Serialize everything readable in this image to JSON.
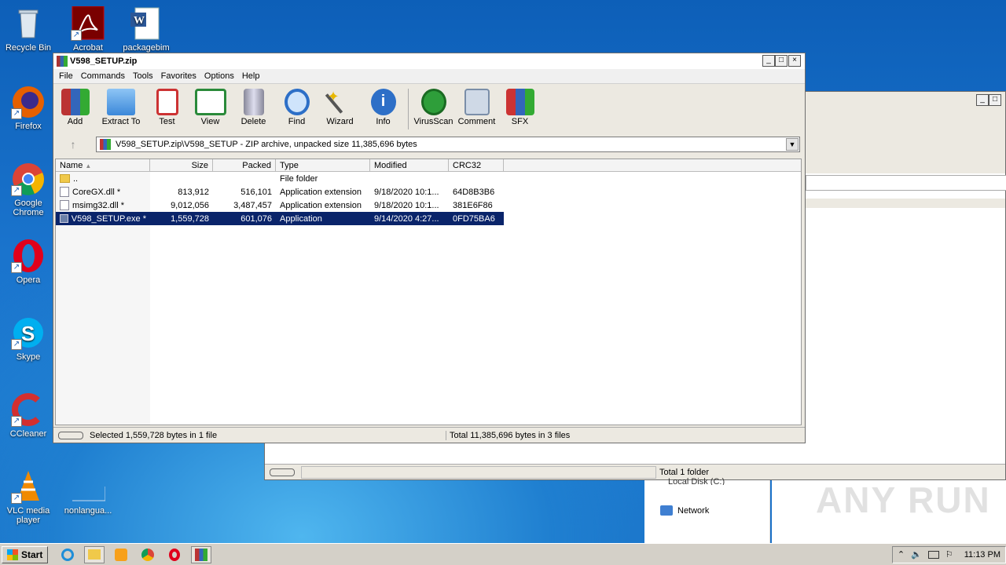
{
  "desktop": {
    "icons": [
      {
        "label": "Recycle Bin"
      },
      {
        "label": "Acrobat"
      },
      {
        "label": "packagebim"
      },
      {
        "label": "Firefox"
      },
      {
        "label": "Google Chrome"
      },
      {
        "label": "Opera"
      },
      {
        "label": "Skype"
      },
      {
        "label": "CCleaner"
      },
      {
        "label": "VLC media player"
      },
      {
        "label": "nonlangua..."
      }
    ]
  },
  "window": {
    "title": "V598_SETUP.zip",
    "menu": [
      "File",
      "Commands",
      "Tools",
      "Favorites",
      "Options",
      "Help"
    ],
    "toolbar": [
      "Add",
      "Extract To",
      "Test",
      "View",
      "Delete",
      "Find",
      "Wizard",
      "Info",
      "VirusScan",
      "Comment",
      "SFX"
    ],
    "address": "V598_SETUP.zip\\V598_SETUP - ZIP archive, unpacked size 11,385,696 bytes",
    "columns": [
      "Name",
      "Size",
      "Packed",
      "Type",
      "Modified",
      "CRC32"
    ],
    "rows": [
      {
        "name": "..",
        "size": "",
        "packed": "",
        "type": "File folder",
        "modified": "",
        "crc": ""
      },
      {
        "name": "CoreGX.dll *",
        "size": "813,912",
        "packed": "516,101",
        "type": "Application extension",
        "modified": "9/18/2020 10:1...",
        "crc": "64D8B3B6"
      },
      {
        "name": "msimg32.dll *",
        "size": "9,012,056",
        "packed": "3,487,457",
        "type": "Application extension",
        "modified": "9/18/2020 10:1...",
        "crc": "381E6F86"
      },
      {
        "name": "V598_SETUP.exe *",
        "size": "1,559,728",
        "packed": "601,076",
        "type": "Application",
        "modified": "9/14/2020 4:27...",
        "crc": "0FD75BA6"
      }
    ],
    "status_left": "Selected 1,559,728 bytes in 1 file",
    "status_right": "Total 11,385,696 bytes in 3 files"
  },
  "back_window": {
    "status": "Total 1 folder",
    "nav_items": [
      "Local Disk (C:)",
      "Network"
    ]
  },
  "watermark": "ANY RUN",
  "taskbar": {
    "start": "Start",
    "clock": "11:13 PM"
  },
  "colors": {
    "selection": "#0a246a",
    "desktop": "#1c79d0"
  }
}
